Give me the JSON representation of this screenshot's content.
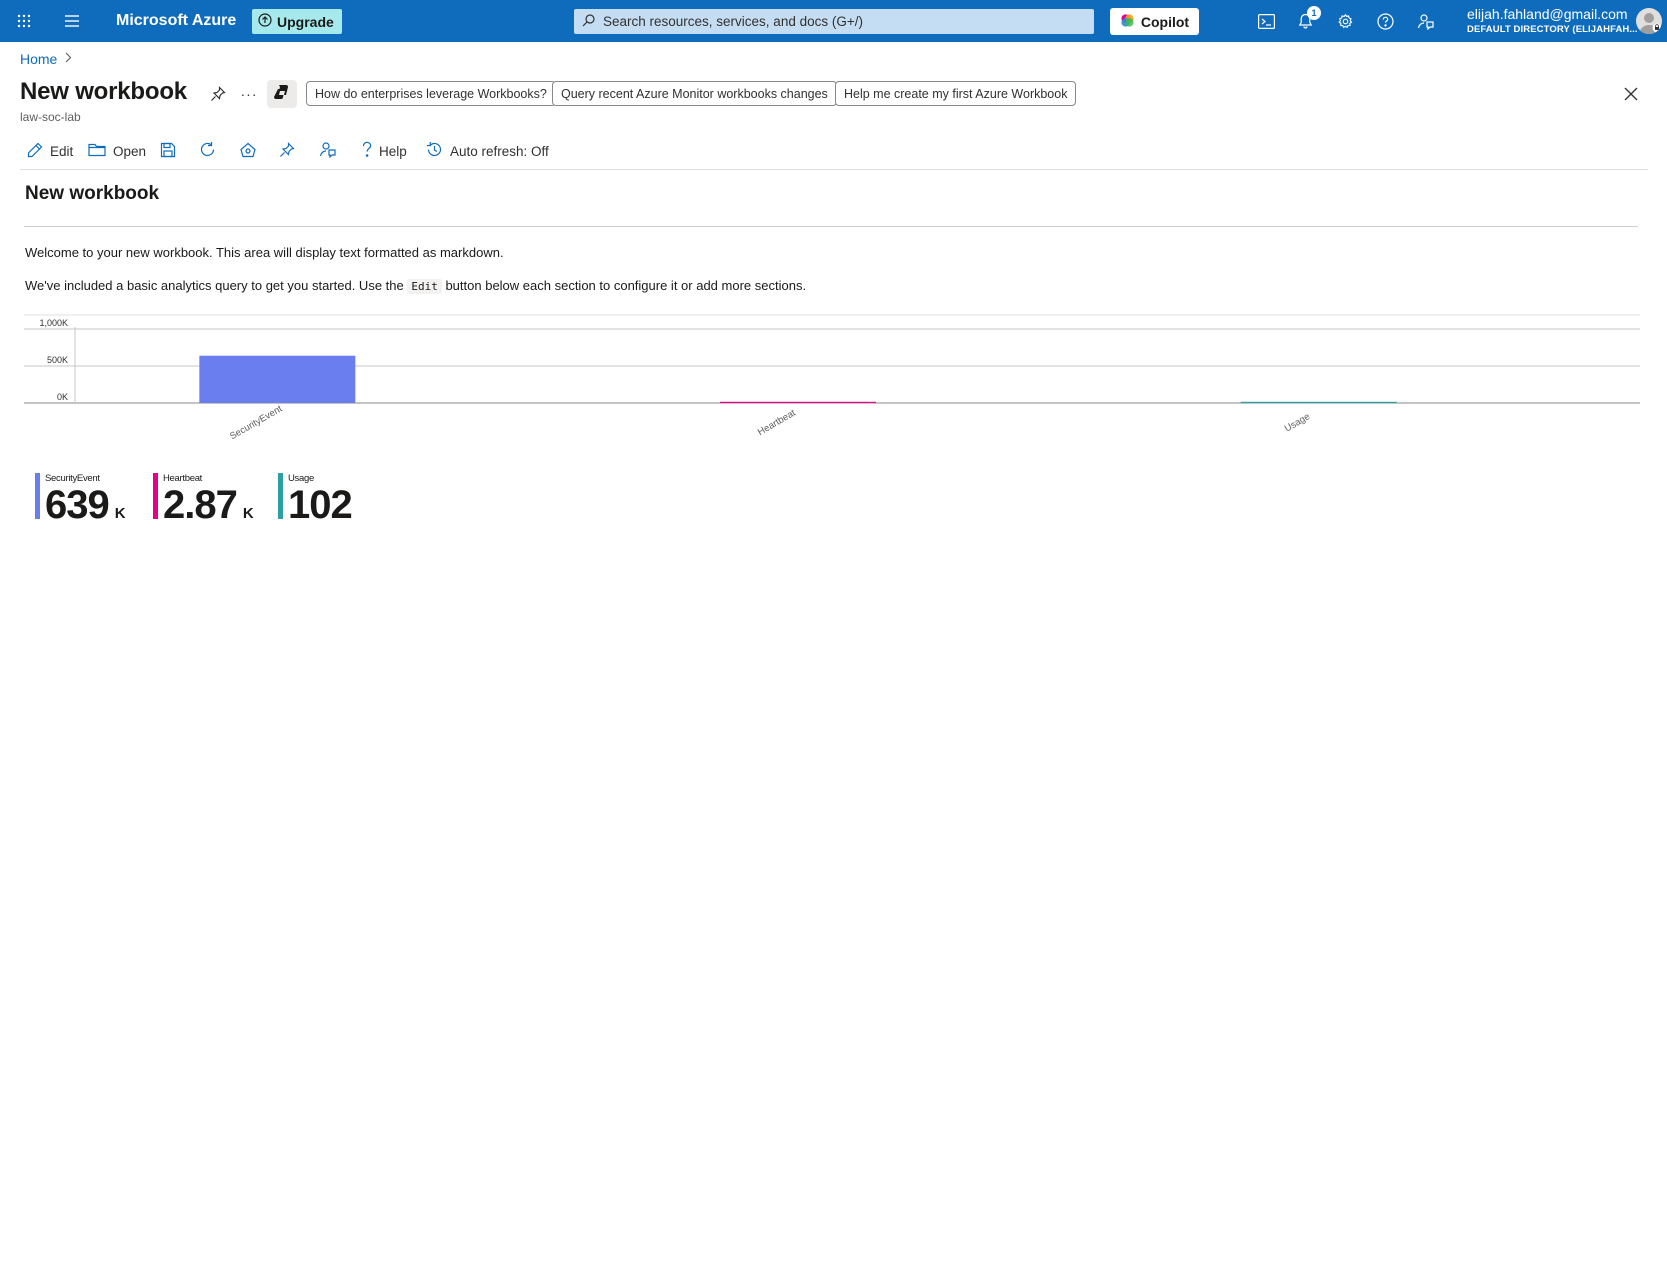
{
  "topbar": {
    "brand": "Microsoft Azure",
    "upgrade_label": "Upgrade",
    "search_placeholder": "Search resources, services, and docs (G+/)",
    "copilot_label": "Copilot",
    "notification_count": "1",
    "account_email": "elijah.fahland@gmail.com",
    "account_directory": "DEFAULT DIRECTORY (ELIJAHFAH..."
  },
  "breadcrumb": {
    "home": "Home"
  },
  "header": {
    "title": "New workbook",
    "subtitle": "law-soc-lab",
    "more_label": "···",
    "suggestions": [
      "How do enterprises leverage Workbooks?",
      "Query recent Azure Monitor workbooks changes",
      "Help me create my first Azure Workbook"
    ]
  },
  "toolbar": {
    "edit_label": "Edit",
    "open_label": "Open",
    "help_label": "Help",
    "autorefresh_label": "Auto refresh: Off"
  },
  "workbook": {
    "title": "New workbook",
    "para1": "Welcome to your new workbook. This area will display text formatted as markdown.",
    "para2_before": "We've included a basic analytics query to get you started. Use the ",
    "para2_code": "Edit",
    "para2_after": " button below each section to configure it or add more sections."
  },
  "chart_data": {
    "type": "bar",
    "categories": [
      "SecurityEvent",
      "Heartbeat",
      "Usage"
    ],
    "values": [
      639000,
      2870,
      102
    ],
    "colors": [
      "#6b7ef0",
      "#e3008c",
      "#2aa0a4"
    ],
    "ylim": [
      0,
      1000000
    ],
    "yticks": [
      "1,000K",
      "500K",
      "0K"
    ],
    "ytick_values": [
      1000000,
      500000,
      0
    ],
    "grid": true
  },
  "tiles": [
    {
      "label": "SecurityEvent",
      "value": "639",
      "unit": "K",
      "color": "#6b7ef0"
    },
    {
      "label": "Heartbeat",
      "value": "2.87",
      "unit": "K",
      "color": "#e3008c"
    },
    {
      "label": "Usage",
      "value": "102",
      "unit": "",
      "color": "#2aa0a4"
    }
  ]
}
